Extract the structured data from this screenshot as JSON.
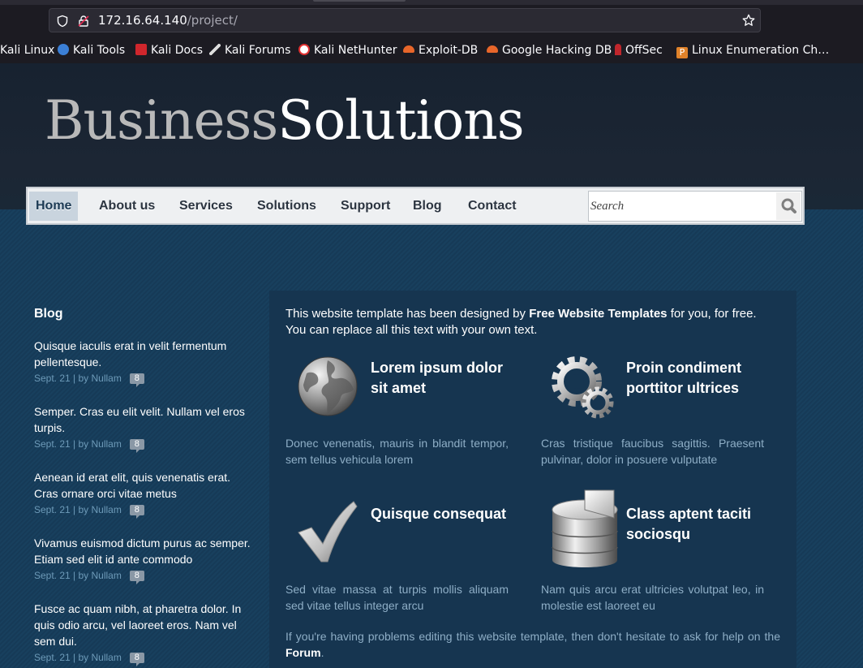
{
  "browser": {
    "url_host": "172.16.64.140",
    "url_path": "/project/",
    "bookmarks": [
      {
        "label": "Kali Linux",
        "icon": "kali-dragon-icon",
        "color": "#2a6ac0"
      },
      {
        "label": "Kali Tools",
        "icon": "kali-tools-icon",
        "color": "#3b7fd6"
      },
      {
        "label": "Kali Docs",
        "icon": "kali-docs-icon",
        "color": "#d0262c"
      },
      {
        "label": "Kali Forums",
        "icon": "kali-forums-icon",
        "color": "#cccccc"
      },
      {
        "label": "Kali NetHunter",
        "icon": "nethunter-icon",
        "color": "#e03030"
      },
      {
        "label": "Exploit-DB",
        "icon": "exploit-db-icon",
        "color": "#e8662a"
      },
      {
        "label": "Google Hacking DB",
        "icon": "ghdb-icon",
        "color": "#e8662a"
      },
      {
        "label": "OffSec",
        "icon": "offsec-icon",
        "color": "#c0262c"
      },
      {
        "label": "Linux Enumeration Ch…",
        "icon": "enumeration-icon",
        "color": "#e0822a"
      }
    ]
  },
  "site": {
    "logo_part1": "Business",
    "logo_part2": "Solutions",
    "nav": [
      "Home",
      "About us",
      "Services",
      "Solutions",
      "Support",
      "Blog",
      "Contact"
    ],
    "search_placeholder": "Search"
  },
  "sidebar": {
    "title": "Blog",
    "posts": [
      {
        "text": "Quisque iaculis erat in velit fermentum pellentesque.",
        "meta": "Sept. 21 | by Nullam",
        "count": "8"
      },
      {
        "text": "Semper. Cras eu elit velit. Nullam vel eros turpis.",
        "meta": "Sept. 21 | by Nullam",
        "count": "8"
      },
      {
        "text": "Aenean id erat elit, quis venenatis erat. Cras ornare orci vitae metus",
        "meta": "Sept. 21 | by Nullam",
        "count": "8"
      },
      {
        "text": "Vivamus euismod dictum purus ac semper. Etiam sed elit id ante commodo",
        "meta": "Sept. 21 | by Nullam",
        "count": "8"
      },
      {
        "text": "Fusce ac quam nibh, at pharetra dolor. In quis odio arcu, vel laoreet eros. Nam vel sem dui.",
        "meta": "Sept. 21 | by Nullam",
        "count": "8"
      }
    ]
  },
  "main": {
    "intro_pre": "This website template has been designed by ",
    "intro_bold": "Free Website Templates",
    "intro_post": " for you, for free. You can replace all this text with your own text.",
    "features": [
      {
        "title": "Lorem ipsum dolor sit amet",
        "text": "Donec venenatis, mauris in blandit tempor, sem tellus vehicula lorem",
        "icon": "globe-icon"
      },
      {
        "title": "Proin condiment porttitor ultrices",
        "text": "Cras tristique faucibus sagittis. Praesent pulvinar, dolor in posuere vulputate",
        "icon": "gears-icon"
      },
      {
        "title": "Quisque consequat",
        "text": "Sed vitae massa at turpis mollis aliquam sed vitae tellus integer arcu",
        "icon": "checkmark-icon"
      },
      {
        "title": "Class aptent taciti sociosqu",
        "text": "Nam quis arcu erat ultricies volutpat leo, in molestie est laoreet eu",
        "icon": "database-icon"
      }
    ],
    "footer_pre": "If you're having problems editing this website template, then don't hesitate to ask for help on the ",
    "footer_link": "Forum",
    "footer_post": "."
  }
}
